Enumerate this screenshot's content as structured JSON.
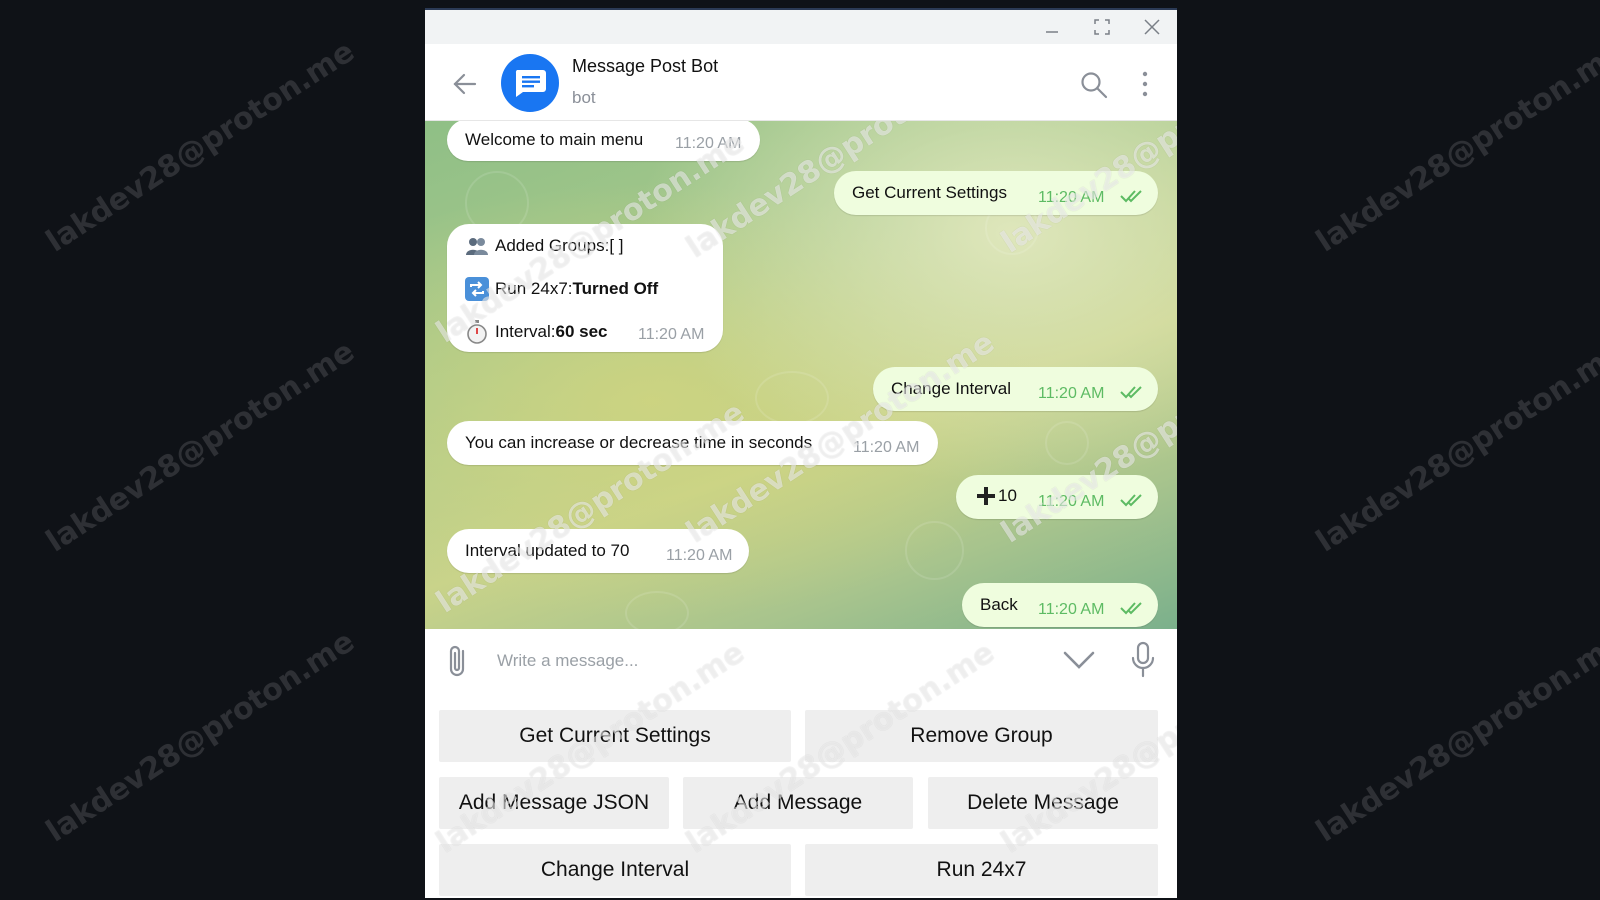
{
  "watermark": "lakdev28@proton.me",
  "window_controls": [
    "minimize",
    "maximize",
    "close"
  ],
  "header": {
    "title": "Message Post Bot",
    "subtitle": "bot"
  },
  "messages": [
    {
      "dir": "in",
      "text": "Welcome to main menu",
      "time": "11:20 AM"
    },
    {
      "dir": "out",
      "text": "Get Current Settings",
      "time": "11:20 AM"
    },
    {
      "dir": "in",
      "lines": [
        {
          "icon": "people-emoji",
          "label": "Added Groups: ",
          "value": "[ ]"
        },
        {
          "icon": "repeat-emoji",
          "label": "Run 24x7: ",
          "value": "Turned Off"
        },
        {
          "icon": "stopwatch-emoji",
          "label": "Interval: ",
          "value": "60 sec"
        }
      ],
      "time": "11:20 AM"
    },
    {
      "dir": "out",
      "text": "Change Interval",
      "time": "11:20 AM"
    },
    {
      "dir": "in",
      "text": "You can increase or decrease time in seconds",
      "time": "11:20 AM"
    },
    {
      "dir": "out",
      "text": "10",
      "icon": "plus-emoji",
      "time": "11:20 AM"
    },
    {
      "dir": "in",
      "text": "Interval updated to 70",
      "time": "11:20 AM"
    },
    {
      "dir": "out",
      "text": "Back",
      "time": "11:20 AM"
    }
  ],
  "composer": {
    "placeholder": "Write a message..."
  },
  "keyboard": {
    "row1": [
      "Get Current Settings",
      "Remove Group"
    ],
    "row2": [
      "Add Message JSON",
      "Add Message",
      "Delete Message"
    ],
    "row3": [
      "Change Interval",
      "Run 24x7"
    ]
  },
  "colors": {
    "accent": "#1976f2",
    "outgoing_bubble": "#effdde",
    "read_check": "#5dbb63",
    "key_button": "#eeeeee"
  }
}
